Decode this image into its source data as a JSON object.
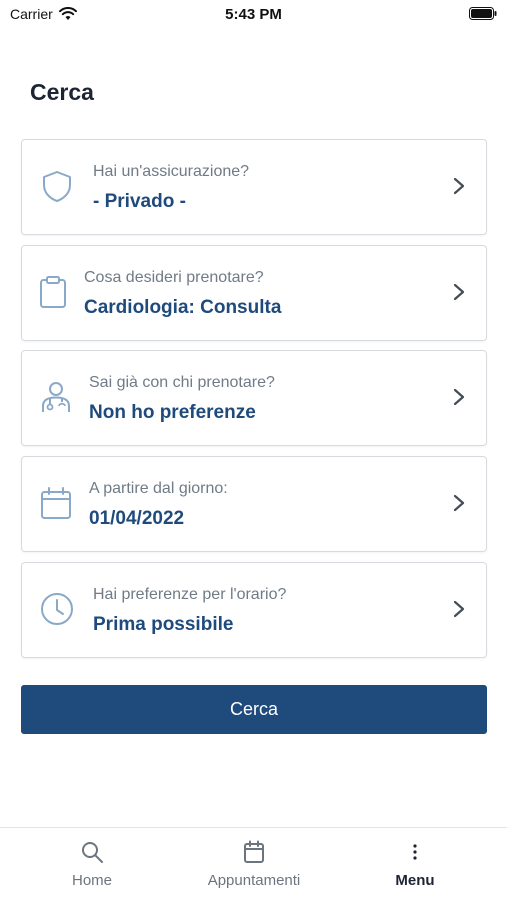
{
  "status_bar": {
    "carrier": "Carrier",
    "time": "5:43 PM"
  },
  "page": {
    "title": "Cerca"
  },
  "cards": [
    {
      "label": "Hai un'assicurazione?",
      "value": "- Privado -",
      "icon": "shield-icon"
    },
    {
      "label": "Cosa desideri prenotare?",
      "value": "Cardiologia: Consulta",
      "icon": "clipboard-icon"
    },
    {
      "label": "Sai già con chi prenotare?",
      "value": "Non ho preferenze",
      "icon": "doctor-icon"
    },
    {
      "label": "A partire dal giorno:",
      "value": "01/04/2022",
      "icon": "calendar-icon"
    },
    {
      "label": "Hai preferenze per l'orario?",
      "value": "Prima possibile",
      "icon": "clock-icon"
    }
  ],
  "search_button": {
    "label": "Cerca"
  },
  "tabbar": {
    "items": [
      {
        "label": "Home",
        "icon": "search-icon"
      },
      {
        "label": "Appuntamenti",
        "icon": "calendar-icon"
      },
      {
        "label": "Menu",
        "icon": "more-vertical-icon",
        "active": true
      }
    ]
  },
  "colors": {
    "primary": "#1f4a7c",
    "label_gray": "#707b87",
    "icon_blue": "#8aa9c8",
    "border": "#d7dbe0"
  }
}
